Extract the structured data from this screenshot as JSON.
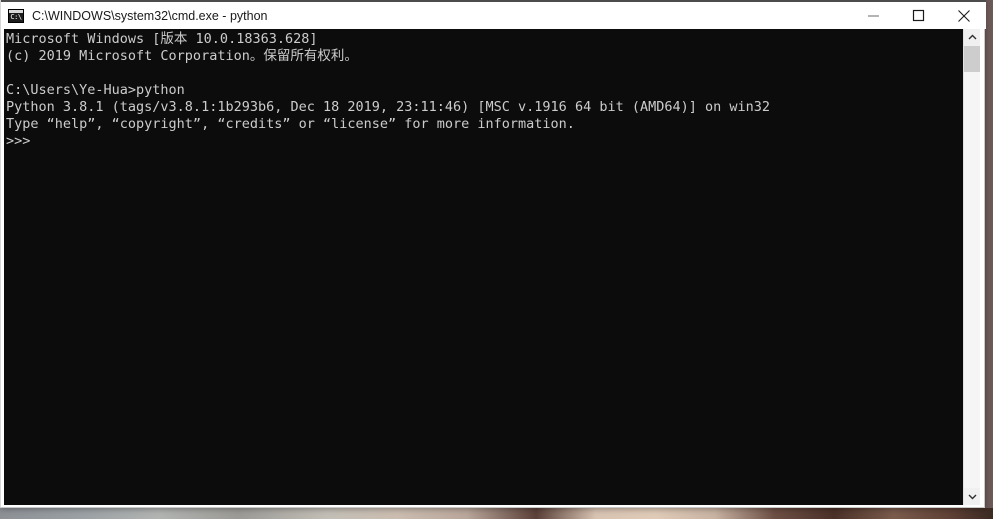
{
  "window": {
    "title": "C:\\WINDOWS\\system32\\cmd.exe - python",
    "icon_name": "cmd-icon",
    "icon_text": "C:\\",
    "controls": {
      "minimize_label": "Minimize",
      "maximize_label": "Maximize",
      "close_label": "Close"
    }
  },
  "console": {
    "background_color": "#0c0c0c",
    "foreground_color": "#cccccc",
    "lines": [
      "Microsoft Windows [版本 10.0.18363.628]",
      "(c) 2019 Microsoft Corporation。保留所有权利。",
      "",
      "C:\\Users\\Ye-Hua>python",
      "Python 3.8.1 (tags/v3.8.1:1b293b6, Dec 18 2019, 23:11:46) [MSC v.1916 64 bit (AMD64)] on win32",
      "Type “help”, “copyright”, “credits” or “license” for more information.",
      ">>>"
    ],
    "text": "Microsoft Windows [版本 10.0.18363.628]\n(c) 2019 Microsoft Corporation。保留所有权利。\n\nC:\\Users\\Ye-Hua>python\nPython 3.8.1 (tags/v3.8.1:1b293b6, Dec 18 2019, 23:11:46) [MSC v.1916 64 bit (AMD64)] on win32\nType “help”, “copyright”, “credits” or “license” for more information.\n>>>"
  },
  "scrollbar": {
    "up_arrow_name": "scroll-up-arrow",
    "down_arrow_name": "scroll-down-arrow",
    "thumb_name": "scrollbar-thumb"
  }
}
